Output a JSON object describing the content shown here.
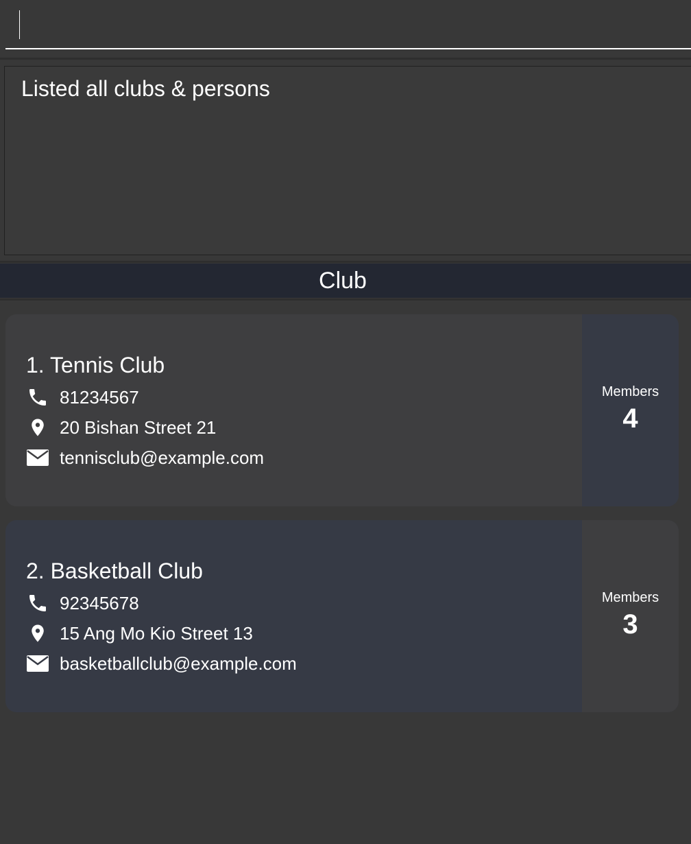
{
  "command_box": {
    "value": "",
    "placeholder": ""
  },
  "result_display": {
    "message": "Listed all clubs & persons"
  },
  "list_header": {
    "title": "Club"
  },
  "clubs": [
    {
      "title": "1. Tennis Club",
      "phone": "81234567",
      "address": "20 Bishan Street 21",
      "email": "tennisclub@example.com",
      "members_label": "Members",
      "members_count": "4"
    },
    {
      "title": "2. Basketball Club",
      "phone": "92345678",
      "address": "15 Ang Mo Kio Street 13",
      "email": "basketballclub@example.com",
      "members_label": "Members",
      "members_count": "3"
    }
  ],
  "icons": {
    "phone": "phone-icon",
    "address": "location-pin-icon",
    "email": "envelope-icon"
  },
  "colors": {
    "background": "#383838",
    "header_background": "#232732",
    "card_grey": "#3e3e40",
    "card_blue": "#363a45",
    "text": "#ffffff"
  }
}
